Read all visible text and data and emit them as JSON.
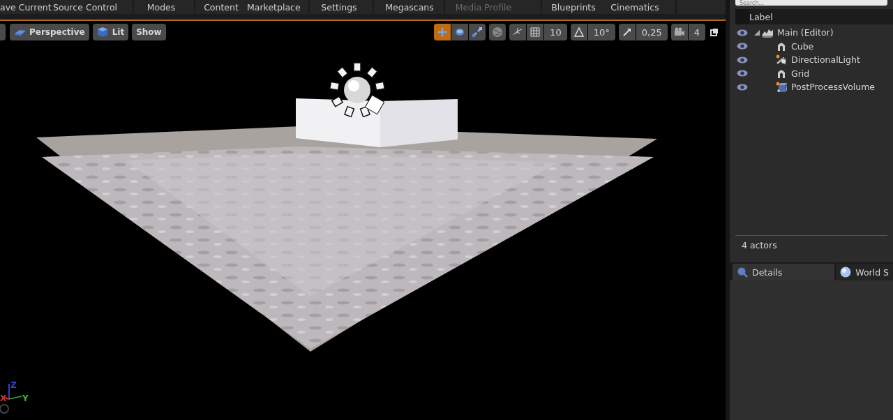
{
  "main_toolbar": [
    {
      "label": "ave Current",
      "disabled": false
    },
    {
      "label": "Source Control",
      "disabled": false
    },
    {
      "label": "Modes",
      "disabled": false
    },
    {
      "label": "Content",
      "disabled": false
    },
    {
      "label": "Marketplace",
      "disabled": false
    },
    {
      "label": "Settings",
      "disabled": false
    },
    {
      "label": "Megascans",
      "disabled": false
    },
    {
      "label": "Media Profile",
      "disabled": true
    },
    {
      "label": "Blueprints",
      "disabled": false
    },
    {
      "label": "Cinematics",
      "disabled": false
    }
  ],
  "viewport": {
    "view_buttons": [
      {
        "label": "Perspective",
        "kind": "perspective"
      },
      {
        "label": "Lit",
        "kind": "lit"
      },
      {
        "label": "Show",
        "kind": "show"
      }
    ],
    "transform_tools": [
      {
        "kind": "translate",
        "selected": true
      },
      {
        "kind": "rotate",
        "selected": false
      },
      {
        "kind": "scale",
        "selected": false
      }
    ],
    "snaps": [
      {
        "kind": "grid",
        "value": "10"
      },
      {
        "kind": "rotation",
        "value": "10°"
      },
      {
        "kind": "scale",
        "value": "0,25"
      },
      {
        "kind": "camera",
        "value": "4"
      }
    ],
    "axes": {
      "x": "X",
      "y": "Y",
      "z": "Z"
    }
  },
  "outliner": {
    "search": {
      "placeholder": "Search..."
    },
    "column": "Label",
    "tree": [
      {
        "label": "Main (Editor)",
        "kind": "world",
        "expanded": true,
        "children": [
          {
            "label": "Cube",
            "kind": "mesh"
          },
          {
            "label": "DirectionalLight",
            "kind": "light"
          },
          {
            "label": "Grid",
            "kind": "mesh"
          },
          {
            "label": "PostProcessVolume",
            "kind": "volume"
          }
        ]
      }
    ],
    "status": "4 actors"
  },
  "details_tabs": [
    {
      "label": "Details",
      "kind": "details",
      "selected": true
    },
    {
      "label": "World S",
      "kind": "world",
      "selected": false
    }
  ]
}
